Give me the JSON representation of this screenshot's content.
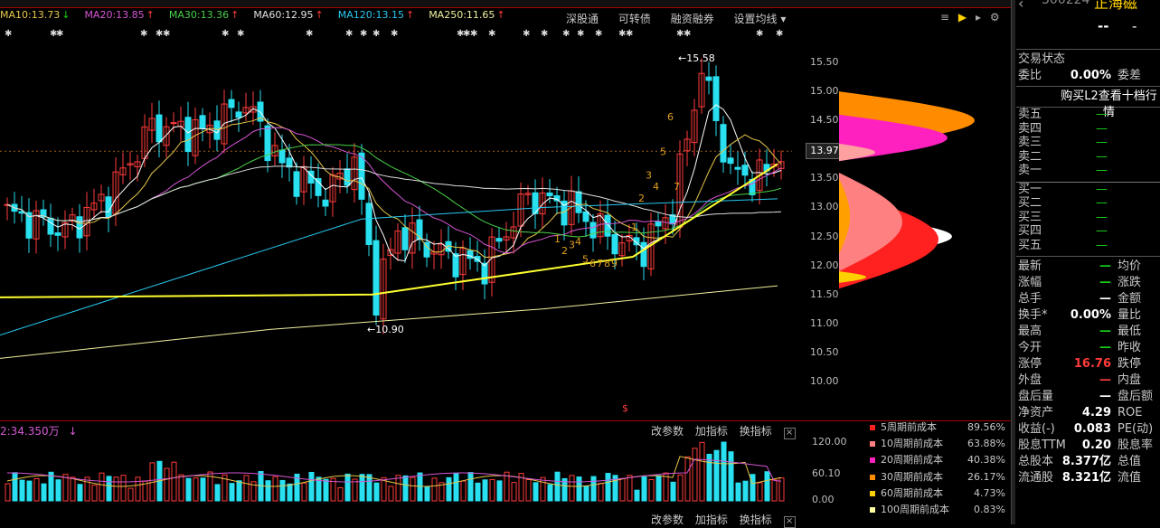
{
  "stock": {
    "code_partial": "300224",
    "name_partial": "正海磁",
    "dash1": "--",
    "dash2": "-"
  },
  "ma_bar": [
    {
      "label": "MA10:13.73",
      "arrow": "↓",
      "dir": "dn",
      "color": "#e8c84a"
    },
    {
      "label": "MA20:13.85",
      "arrow": "↑",
      "dir": "up",
      "color": "#d455d4"
    },
    {
      "label": "MA30:13.36",
      "arrow": "↑",
      "dir": "up",
      "color": "#48d048"
    },
    {
      "label": "MA60:12.95",
      "arrow": "↑",
      "dir": "up",
      "color": "#e0e0e0"
    },
    {
      "label": "MA120:13.15",
      "arrow": "↑",
      "dir": "up",
      "color": "#28c8f0"
    },
    {
      "label": "MA250:11.65",
      "arrow": "↑",
      "dir": "up",
      "color": "#f0f0a0"
    }
  ],
  "menu": {
    "item1": "深股通",
    "item2": "可转债",
    "item3": "融资融券",
    "item4": "设置均线 ▾"
  },
  "price_axis": [
    "15.50",
    "15.00",
    "14.50",
    "14.00",
    "13.50",
    "13.00",
    "12.50",
    "12.00",
    "11.50",
    "11.00",
    "10.50",
    "10.00"
  ],
  "current_price": "13.97",
  "annotations": {
    "high": "15.58",
    "low": "10.90"
  },
  "counts_low": [
    "1",
    "2",
    "3",
    "4",
    "5",
    "6",
    "7",
    "8",
    "9"
  ],
  "counts_up": [
    "1",
    "2",
    "3",
    "4",
    "5",
    "6",
    "7"
  ],
  "volume": {
    "title": "2:34.350万",
    "arrow": "↓",
    "menu": {
      "item1": "改参数",
      "item2": "加指标",
      "item3": "换指标",
      "close": "×"
    },
    "axis": [
      "120.00",
      "60.10",
      "0.00"
    ]
  },
  "bottom_menu": {
    "item1": "改参数",
    "item2": "加指标",
    "item3": "换指标",
    "close": "×"
  },
  "cost": [
    {
      "label": "5周期前成本",
      "value": "89.56%",
      "color": "#ff2020"
    },
    {
      "label": "10周期前成本",
      "value": "63.88%",
      "color": "#ff8080"
    },
    {
      "label": "20周期前成本",
      "value": "40.38%",
      "color": "#ff20c0"
    },
    {
      "label": "30周期前成本",
      "value": "26.17%",
      "color": "#ff8c00"
    },
    {
      "label": "60周期前成本",
      "value": "4.73%",
      "color": "#ffd000"
    },
    {
      "label": "100周期前成本",
      "value": "0.83%",
      "color": "#ffffa0"
    }
  ],
  "right_panel": {
    "trade_status": "交易状态",
    "weibi_label": "委比",
    "weibi_val": "0.00%",
    "weicha_label": "委差",
    "l2_link": "购买L2查看十档行情",
    "sell_levels": [
      "卖五",
      "卖四",
      "卖三",
      "卖二",
      "卖一"
    ],
    "buy_levels": [
      "买一",
      "买二",
      "买三",
      "买四",
      "买五"
    ],
    "dash": "—",
    "rows": [
      {
        "l": "最新",
        "v": "—",
        "vc": "green",
        "r": "均价"
      },
      {
        "l": "涨幅",
        "v": "—",
        "vc": "green",
        "r": "涨跌"
      },
      {
        "l": "总手",
        "v": "—",
        "vc": "white",
        "r": "金额"
      },
      {
        "l": "换手*",
        "v": "0.00%",
        "vc": "white",
        "r": "量比"
      },
      {
        "l": "最高",
        "v": "—",
        "vc": "green",
        "r": "最低"
      },
      {
        "l": "今开",
        "v": "—",
        "vc": "green",
        "r": "昨收"
      },
      {
        "l": "涨停",
        "v": "16.76",
        "vc": "red",
        "r": "跌停"
      },
      {
        "l": "外盘",
        "v": "—",
        "vc": "red",
        "r": "内盘"
      },
      {
        "l": "盘后量",
        "v": "—",
        "vc": "white",
        "r": "盘后额"
      },
      {
        "l": "净资产",
        "v": "4.29",
        "vc": "white",
        "r": "ROE"
      },
      {
        "l": "收益(-)",
        "v": "0.083",
        "vc": "white",
        "r": "PE(动)"
      },
      {
        "l": "股息TTM",
        "v": "0.20",
        "vc": "white",
        "r": "股息率"
      },
      {
        "l": "总股本",
        "v": "8.377亿",
        "vc": "white",
        "r": "总值"
      },
      {
        "l": "流通股",
        "v": "8.321亿",
        "vc": "white",
        "r": "流值"
      }
    ]
  }
}
